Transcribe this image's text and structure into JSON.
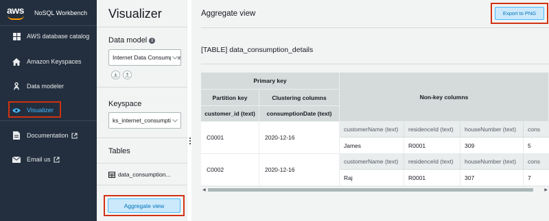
{
  "app": {
    "logo_text": "aws",
    "title": "NoSQL Workbench"
  },
  "nav": {
    "items": [
      {
        "label": "AWS database catalog"
      },
      {
        "label": "Amazon Keyspaces"
      },
      {
        "label": "Data modeler"
      },
      {
        "label": "Visualizer"
      },
      {
        "label": "Documentation"
      },
      {
        "label": "Email us"
      }
    ]
  },
  "visualizer": {
    "title": "Visualizer",
    "data_model_label": "Data model",
    "data_model_value": "Internet Data Consumption",
    "keyspace_label": "Keyspace",
    "keyspace_value": "ks_internet_consumption",
    "tables_label": "Tables",
    "table_item": "data_consumption...",
    "aggregate_button": "Aggregate view"
  },
  "main": {
    "title": "Aggregate view",
    "export_button": "Export to PNG",
    "table_name": "[TABLE] data_consumption_details"
  },
  "grid": {
    "primary_key": "Primary key",
    "partition_key": "Partition key",
    "clustering_columns": "Clustering columns",
    "non_key_columns": "Non-key columns",
    "pk_col": "customer_id (text)",
    "ck_col": "consumptionDate (text)",
    "nk_cols": [
      "customerName (text)",
      "residenceId (text)",
      "houseNumber (text)",
      "cons"
    ],
    "rows": [
      {
        "pk": "C0001",
        "ck": "2020-12-16",
        "values": [
          "James",
          "R0001",
          "309",
          "5"
        ]
      },
      {
        "pk": "C0002",
        "ck": "2020-12-16",
        "values": [
          "Raj",
          "R0001",
          "307",
          "7"
        ]
      }
    ]
  },
  "colors": {
    "nav_bg": "#232f3e",
    "accent": "#44b9ff",
    "highlight": "#d13212",
    "brand_orange": "#ff9900"
  }
}
